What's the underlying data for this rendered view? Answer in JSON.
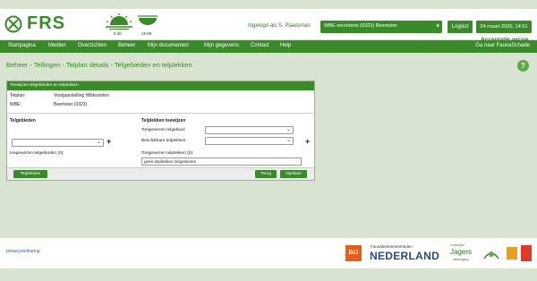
{
  "header": {
    "brand": "FRS",
    "sun_time": "6:36",
    "moon_time": "18:58",
    "logged_in_as": "Ingelogd als S. Plaatsman",
    "org_selected": "WBE secretaris (0323) Beemster",
    "logout_label": "Logout",
    "date_label": "24 maart 2025, 14:51",
    "environment": "Acceptatie versie"
  },
  "nav": {
    "items": [
      "Startpagina",
      "Melden",
      "Overzichten",
      "Beheer",
      "Mijn documenten",
      "Mijn gegevens",
      "Contact",
      "Help"
    ],
    "right": "Ga naar FaunaSchade"
  },
  "breadcrumb": "Beheer - Tellingen - Telplan details - Telgebieden en telplekken",
  "panel": {
    "title": "Toewijzen telgebieden en telplekken",
    "telplan_label": "Telplan:",
    "telplan_value": "Voorjaarstelling Wildsoorten",
    "wbe_label": "WBE:",
    "wbe_value": "Beemster (0323)",
    "left_section": "Telgebieden",
    "left_assigned_label": "toegewezen telgebieden (0):",
    "right_section": "Telplekken toewijzen",
    "assigned_area_label": "Toegewezen telgebied:",
    "available_spots_label": "Beschikbare telplekken:",
    "assigned_spots_label": "Toegewezen telplekken (0):",
    "assigned_spots_value": "geen telplekken toegewezen",
    "btn_telplekken": "Telplekken",
    "btn_terug": "Terug",
    "btn_opslaan": "Opslaan"
  },
  "footer": {
    "privacy": "privacyverklaring",
    "bij12": "BIJ",
    "fauna_small": "Faunabeheereenheden",
    "nederland": "NEDERLAND",
    "jagers_top": "koninklijke",
    "jagers": "Jagers",
    "jagers_sub": "vereniging"
  },
  "colors": {
    "primary_green": "#3a8a2a",
    "page_bg": "#d8e3d0"
  }
}
